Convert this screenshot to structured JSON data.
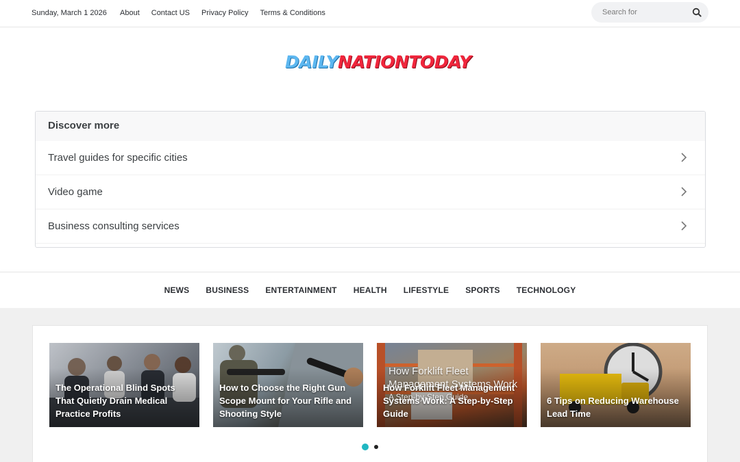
{
  "topbar": {
    "date": "Sunday, March 1 2026",
    "links": [
      "About",
      "Contact US",
      "Privacy Policy",
      "Terms & Conditions"
    ],
    "search_placeholder": "Search for"
  },
  "logo": {
    "part1": "DAILY",
    "part2": "NATIONTODAY"
  },
  "discover": {
    "heading": "Discover more",
    "items": [
      "Travel guides for specific cities",
      "Video game",
      "Business consulting services"
    ]
  },
  "mainnav": [
    "NEWS",
    "BUSINESS",
    "ENTERTAINMENT",
    "HEALTH",
    "LIFESTYLE",
    "SPORTS",
    "TECHNOLOGY"
  ],
  "slides": [
    {
      "title": "The Operational Blind Spots That Quietly Drain Medical Practice Profits"
    },
    {
      "title": "How to Choose the Right Gun Scope Mount for Your Rifle and Shooting Style"
    },
    {
      "title": "How Forklift Fleet Management Systems Work: A Step-by-Step Guide",
      "ghost_title": "How Forklift Fleet Management Systems Work",
      "ghost_sub": "A Step-by-Step Guide"
    },
    {
      "title": "6 Tips on Reducing Warehouse Lead Time"
    }
  ],
  "colors": {
    "accent": "#20b7c2",
    "logo_blue": "#5db7f0",
    "logo_red": "#f0263c"
  }
}
